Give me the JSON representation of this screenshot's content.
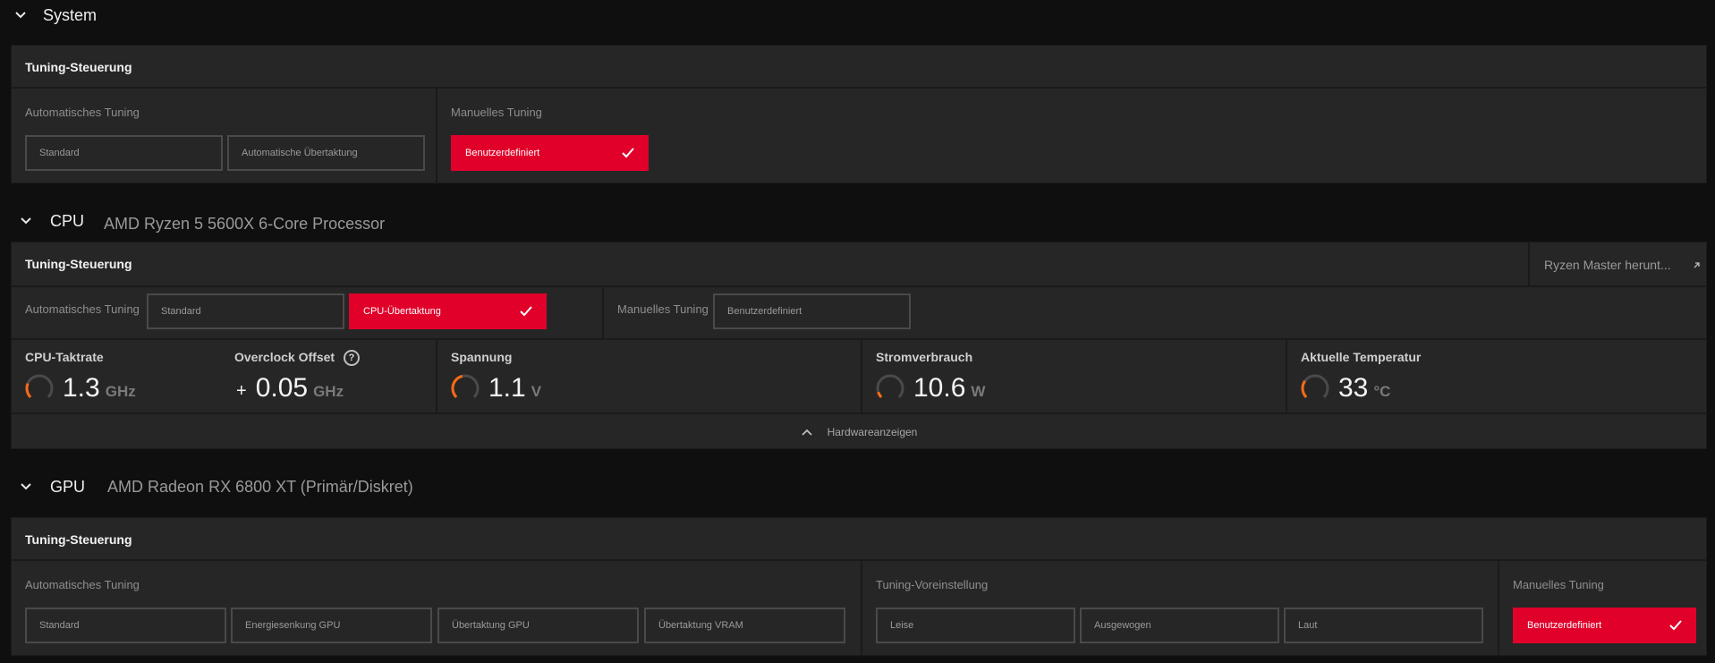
{
  "system": {
    "title": "System",
    "panel_title": "Tuning-Steuerung",
    "auto_label": "Automatisches Tuning",
    "manual_label": "Manuelles Tuning",
    "auto_buttons": [
      "Standard",
      "Automatische Übertaktung"
    ],
    "manual_button": "Benutzerdefiniert"
  },
  "cpu": {
    "title": "CPU",
    "subtitle": "AMD Ryzen 5 5600X 6-Core Processor",
    "panel_title": "Tuning-Steuerung",
    "ryzen_master_link": "Ryzen Master herunt...",
    "auto_label": "Automatisches Tuning",
    "manual_label": "Manuelles Tuning",
    "auto_buttons": [
      "Standard",
      "CPU-Übertaktung"
    ],
    "manual_button": "Benutzerdefiniert",
    "metrics": {
      "clock": {
        "label": "CPU-Taktrate",
        "value": "1.3",
        "unit": "GHz",
        "gauge_fraction": 0.25
      },
      "offset": {
        "label": "Overclock Offset",
        "prefix": "+",
        "value": "0.05",
        "unit": "GHz",
        "help": "?"
      },
      "voltage": {
        "label": "Spannung",
        "value": "1.1",
        "unit": "V",
        "gauge_fraction": 0.45
      },
      "power": {
        "label": "Stromverbrauch",
        "value": "10.6",
        "unit": "W",
        "gauge_fraction": 0.1
      },
      "temp": {
        "label": "Aktuelle Temperatur",
        "value": "33",
        "unit": "°C",
        "gauge_fraction": 0.3
      }
    },
    "hardware_toggle": "Hardwareanzeigen"
  },
  "gpu": {
    "title": "GPU",
    "subtitle": "AMD Radeon RX 6800 XT (Primär/Diskret)",
    "panel_title": "Tuning-Steuerung",
    "auto_label": "Automatisches Tuning",
    "preset_label": "Tuning-Voreinstellung",
    "manual_label": "Manuelles Tuning",
    "auto_buttons": [
      "Standard",
      "Energiesenkung GPU",
      "Übertaktung GPU",
      "Übertaktung VRAM"
    ],
    "preset_buttons": [
      "Leise",
      "Ausgewogen",
      "Laut"
    ],
    "manual_button": "Benutzerdefiniert"
  },
  "colors": {
    "accent": "#e0002a",
    "gauge": "#ff6a13",
    "panel": "#262626",
    "background": "#0f0f0f"
  }
}
